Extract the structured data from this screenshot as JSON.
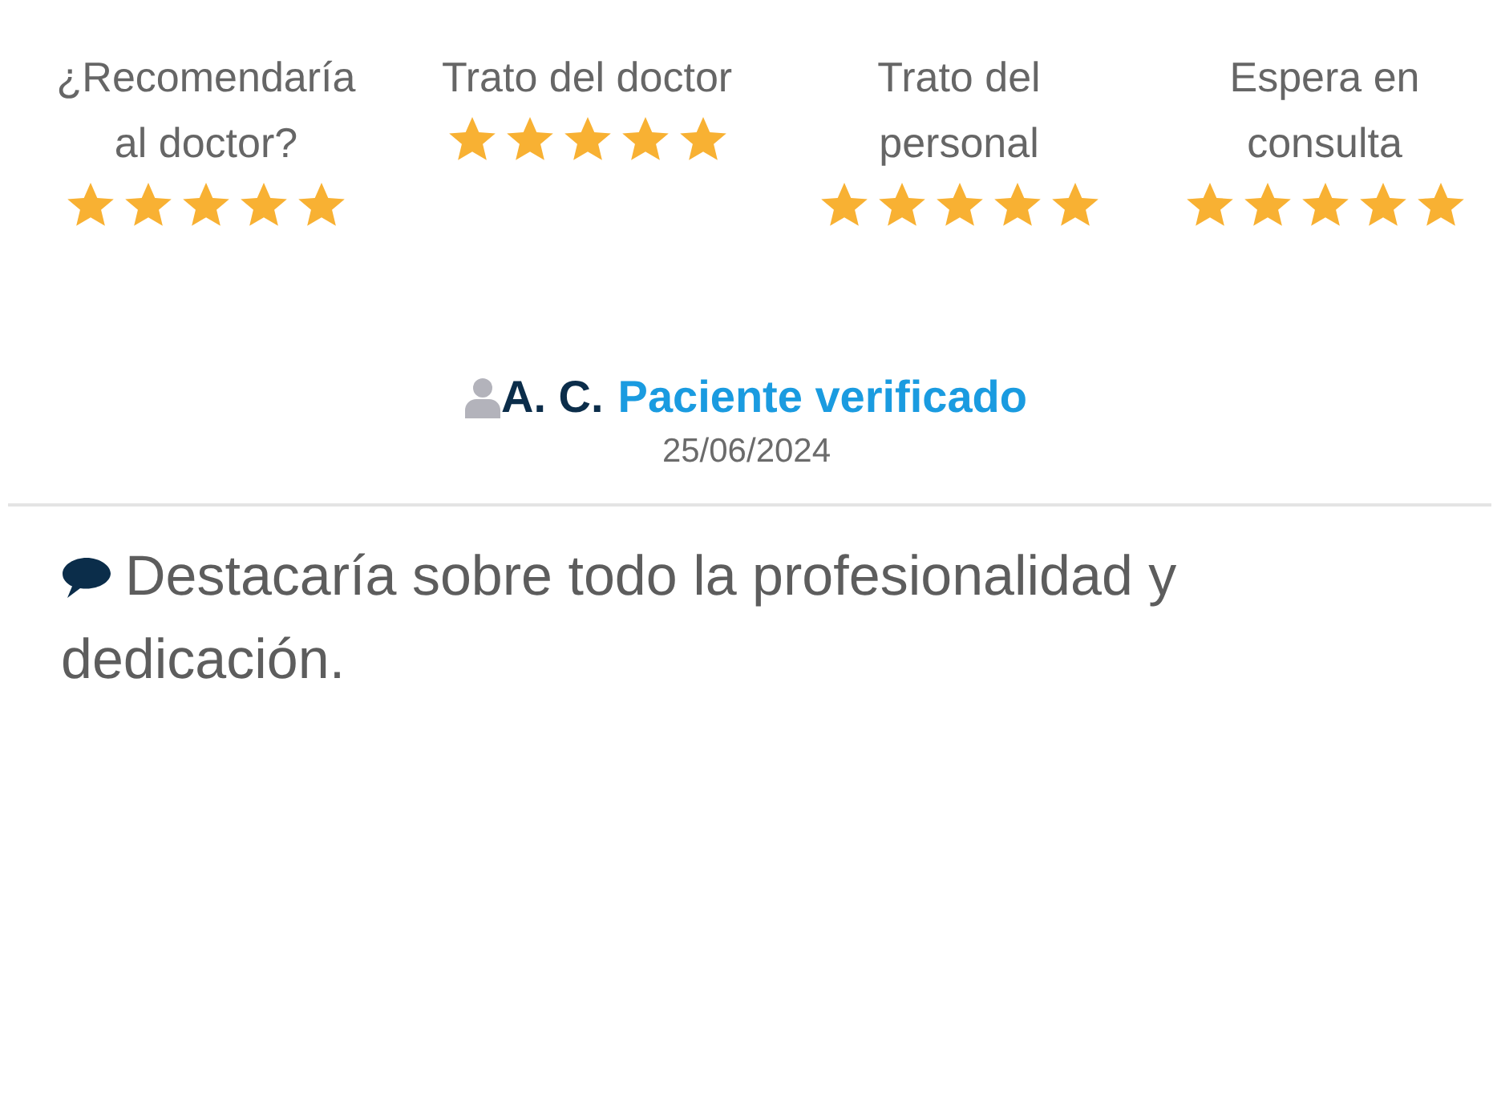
{
  "ratings": [
    {
      "label": "¿Recomendaría al doctor?",
      "stars": 5
    },
    {
      "label": "Trato del doctor",
      "stars": 5
    },
    {
      "label": "Trato del personal",
      "stars": 5
    },
    {
      "label": "Espera en consulta",
      "stars": 5
    }
  ],
  "author": {
    "name": "A. C.",
    "badge": "Paciente verificado",
    "date": "25/06/2024"
  },
  "comment": "Destacaría sobre todo la profesionalidad y dedicación."
}
